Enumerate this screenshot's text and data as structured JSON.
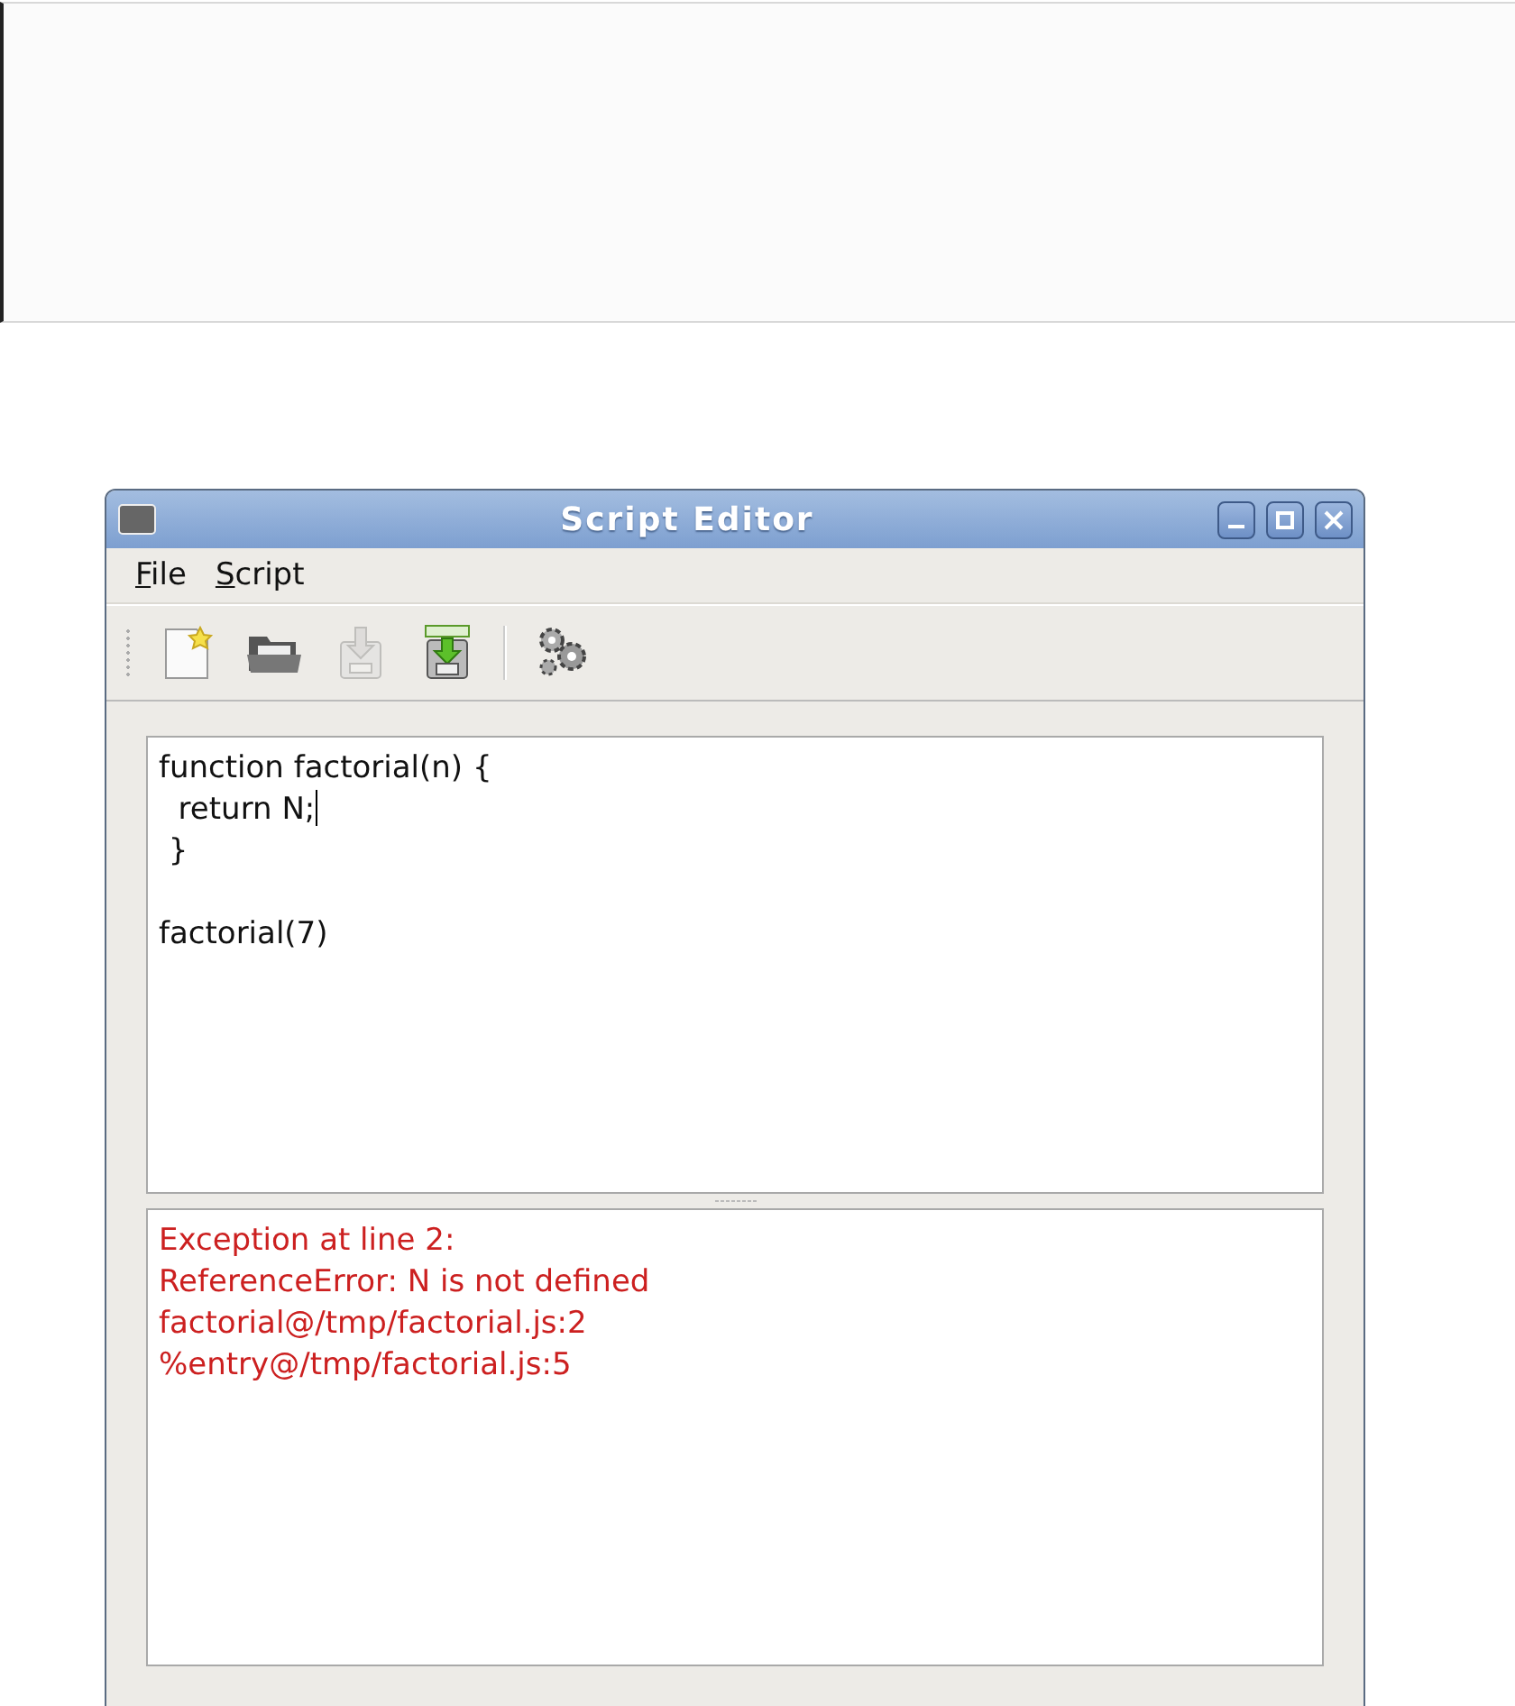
{
  "window": {
    "title": "Script Editor"
  },
  "menu": [
    {
      "label": "File"
    },
    {
      "label": "Script"
    }
  ],
  "toolbar": [
    {
      "kind": "new",
      "disabled": false
    },
    {
      "kind": "open",
      "disabled": false
    },
    {
      "kind": "save",
      "disabled": true
    },
    {
      "kind": "save-as",
      "disabled": false
    },
    {
      "kind": "separator"
    },
    {
      "kind": "run",
      "disabled": false
    }
  ],
  "editor": {
    "lines": [
      {
        "kind": "code",
        "text": "function factorial(n) {",
        "cursor": false
      },
      {
        "kind": "code",
        "text": "  return N;",
        "cursor": true
      },
      {
        "kind": "code",
        "text": " }",
        "cursor": false
      },
      {
        "kind": "blank"
      },
      {
        "kind": "code",
        "text": "factorial(7)",
        "cursor": false
      }
    ]
  },
  "output": {
    "lines": [
      {
        "text": "Exception at line 2:",
        "kind": "error"
      },
      {
        "text": "ReferenceError: N is not defined",
        "kind": "error"
      },
      {
        "text": "factorial@/tmp/factorial.js:2",
        "kind": "error"
      },
      {
        "text": "%entry@/tmp/factorial.js:5",
        "kind": "error"
      }
    ]
  }
}
